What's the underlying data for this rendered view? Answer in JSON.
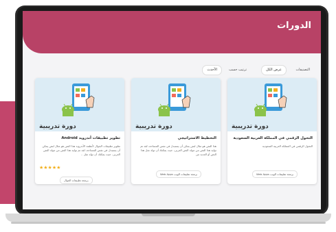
{
  "header": {
    "title": "الدورات"
  },
  "filters": {
    "label": "التصنيفات",
    "all_label": "عرض الكل",
    "sort_label": "ترتيب حسب",
    "newest_label": "الأحدث"
  },
  "banner_text": "دورة تدريبية",
  "cards": [
    {
      "title": "التحول الرقمي في المملكة العربية السعودية",
      "desc": "التحول الرقمي في المملكة العربية السعودية",
      "tag": "برمجة تطبيقات الويب Web Apps"
    },
    {
      "title": "التخطيط الاستراتيجي",
      "desc": "هذا النص هو مثال لنص يمكن أن يستبدل في نفس المساحة، لقد تم توليد هذا النص من مولد النص العربى، حيث يمكنك أن تولد مثل هذا النص أو العديد من",
      "tag": "برمجة تطبيقات الويب Web Apps"
    },
    {
      "title": "تطوير تطبيقات أندرويد Android",
      "desc": "تطوير تطبيقات الجوال لأنظمة الأندرويد هذا النص هو مثال لنص يمكن أن يستبدل في نفس المساحة، لقد تم توليد هذا النص من مولد النص العربى. حيث يمكنك أن تولد مثل ..",
      "stars": "★★★★★",
      "rating": 5,
      "tag": "برمجة تطبيقات الجوال"
    }
  ],
  "colors": {
    "brand": "#b84266",
    "accent_pink": "#c2456b",
    "banner": "#dcecf5",
    "android_green": "#8bc34a",
    "star": "#f2b01e"
  }
}
